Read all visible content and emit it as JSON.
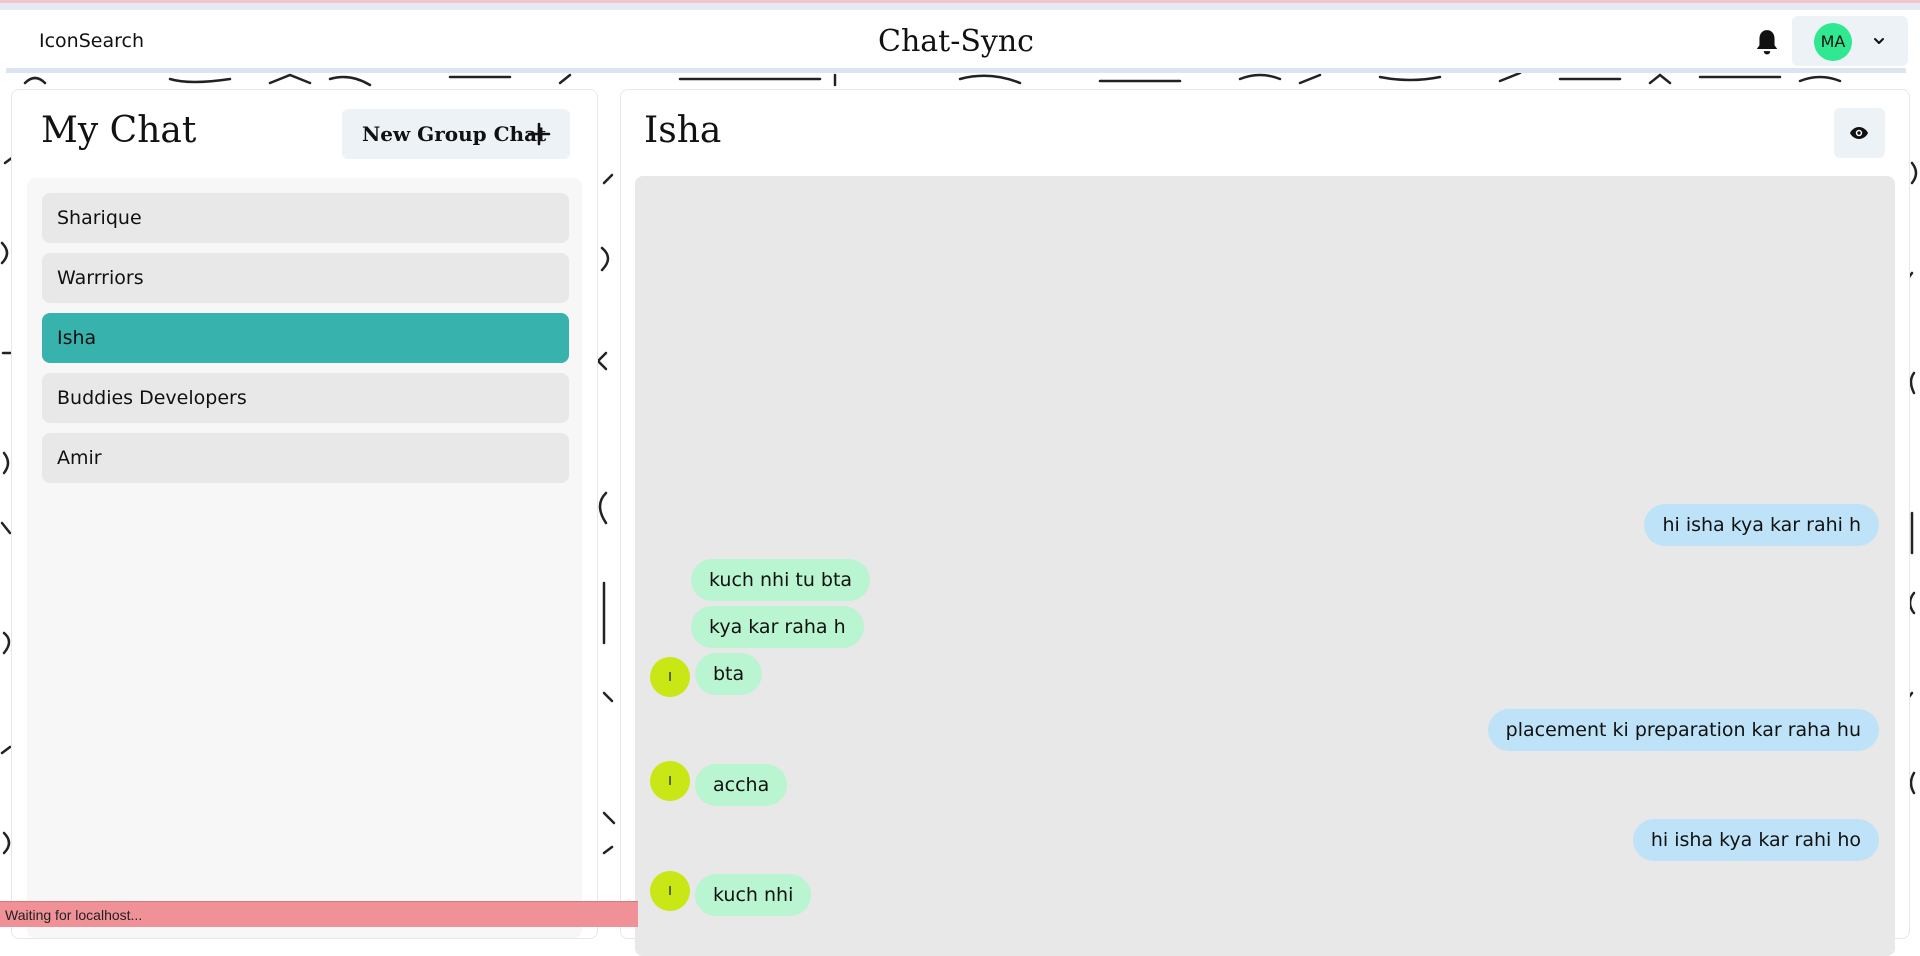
{
  "header": {
    "brand": "IconSearch",
    "title": "Chat-Sync",
    "user_initials": "MA"
  },
  "sidebar": {
    "title": "My Chat",
    "new_group_label": "New Group Chat",
    "chats": [
      "Sharique",
      "Warrriors",
      "Isha",
      "Buddies Developers",
      "Amir"
    ],
    "active_chat": "Isha"
  },
  "conversation": {
    "name": "Isha",
    "avatar_initial": "I",
    "messages": [
      {
        "side": "sent",
        "text": "hi isha kya kar rahi h"
      },
      {
        "side": "received",
        "text": "kuch nhi tu bta"
      },
      {
        "side": "received",
        "text": "kya kar raha h"
      },
      {
        "side": "received",
        "text": "bta"
      },
      {
        "side": "sent",
        "text": "placement ki preparation kar raha hu"
      },
      {
        "side": "received",
        "text": "accha"
      },
      {
        "side": "sent",
        "text": "hi isha kya kar rahi ho"
      },
      {
        "side": "received",
        "text": "kuch nhi"
      }
    ]
  },
  "status_bar": {
    "text": "Waiting for localhost..."
  },
  "colors": {
    "active_chat": "#38b2ac",
    "sent_bubble": "#bee3f8",
    "received_bubble": "#b9f5d0",
    "user_avatar": "#2fe88f",
    "contact_avatar": "#c9e615",
    "status_bar": "#f09198"
  },
  "icons": [
    "bell-icon",
    "chevron-down-icon",
    "plus-icon",
    "eye-icon"
  ]
}
